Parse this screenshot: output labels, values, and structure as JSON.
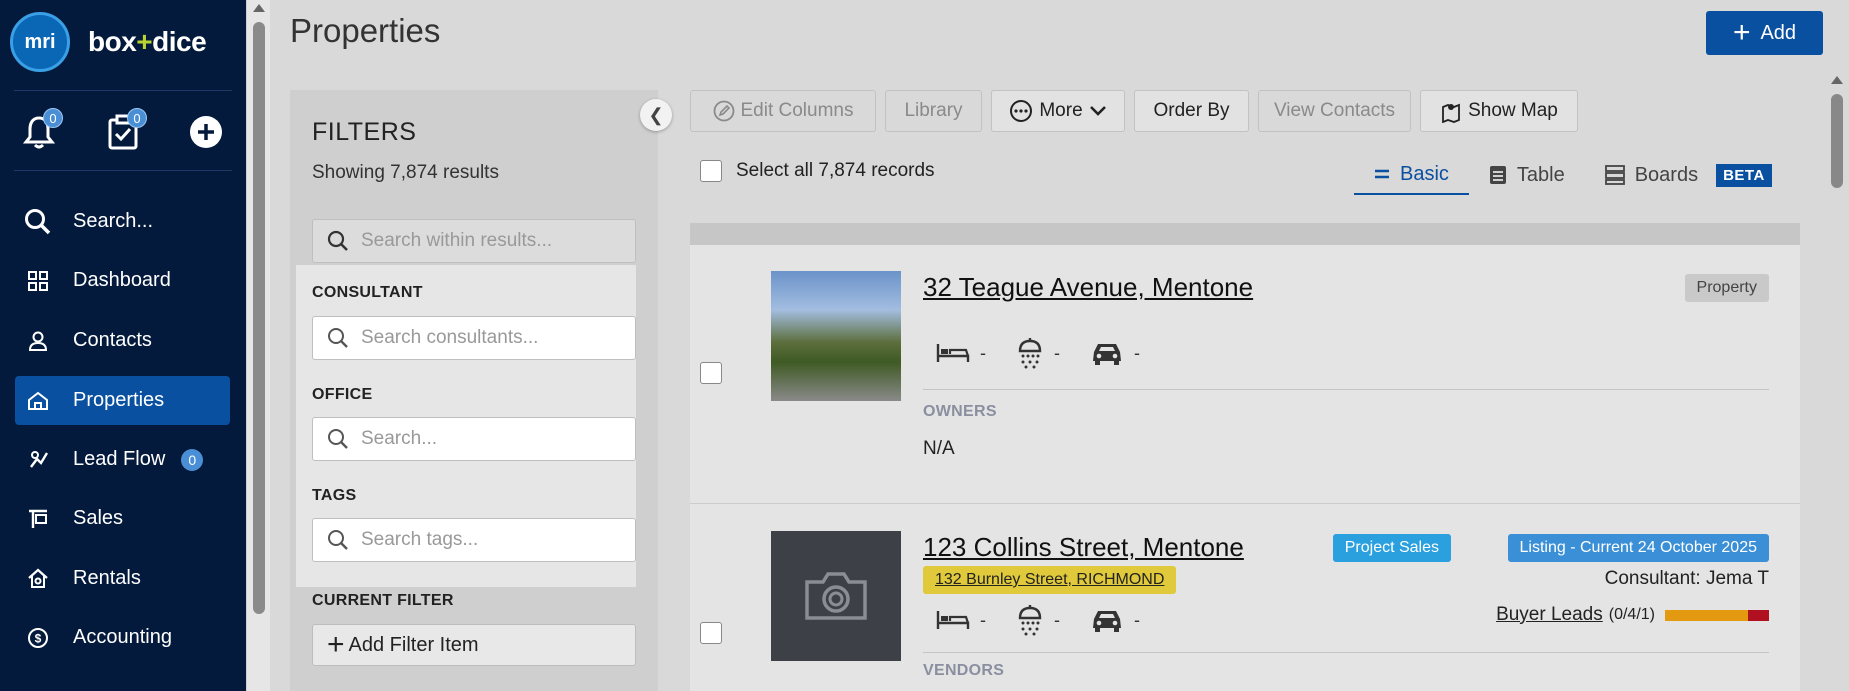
{
  "brand": {
    "logo_text": "mri",
    "name_left": "box",
    "name_plus": "+",
    "name_right": "dice"
  },
  "quick": {
    "notifications_count": "0",
    "tasks_count": "0"
  },
  "nav": {
    "search": "Search...",
    "dashboard": "Dashboard",
    "contacts": "Contacts",
    "properties": "Properties",
    "lead_flow": "Lead Flow",
    "lead_flow_badge": "0",
    "sales": "Sales",
    "rentals": "Rentals",
    "accounting": "Accounting"
  },
  "header": {
    "title": "Properties",
    "add_label": "Add"
  },
  "filters": {
    "title": "FILTERS",
    "showing": "Showing 7,874 results",
    "search_placeholder": "Search within results...",
    "consultant_label": "CONSULTANT",
    "consultant_placeholder": "Search consultants...",
    "office_label": "OFFICE",
    "office_placeholder": "Search...",
    "tags_label": "TAGS",
    "tags_placeholder": "Search tags...",
    "current_filter_label": "CURRENT FILTER",
    "add_filter_label": "Add Filter Item"
  },
  "toolbar": {
    "edit_columns": "Edit Columns",
    "library": "Library",
    "more": "More",
    "order_by": "Order By",
    "view_contacts": "View Contacts",
    "show_map": "Show Map"
  },
  "select_all": "Select all 7,874 records",
  "views": {
    "basic": "Basic",
    "table": "Table",
    "boards": "Boards",
    "beta": "BETA"
  },
  "properties": [
    {
      "address": "32 Teague Avenue, Mentone",
      "tag": "Property",
      "beds": "-",
      "baths": "-",
      "cars": "-",
      "owners_label": "OWNERS",
      "owners_value": "N/A"
    },
    {
      "address": "123 Collins Street, Mentone",
      "linked_address": "132 Burnley Street, RICHMOND",
      "tag_project": "Project Sales",
      "tag_listing": "Listing - Current 24 October 2025",
      "consultant": "Consultant: Jema T",
      "buyer_leads_label": "Buyer Leads",
      "buyer_leads_counts": "(0/4/1)",
      "buyer_leads_mix": [
        4,
        1
      ],
      "beds": "-",
      "baths": "-",
      "cars": "-",
      "vendors_label": "VENDORS"
    }
  ]
}
